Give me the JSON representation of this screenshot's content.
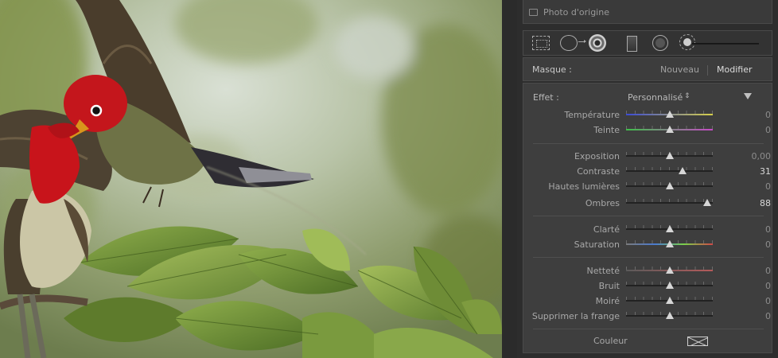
{
  "colors": {
    "panel_bg": "#2d2d2d",
    "section_bg": "#3e3e3e",
    "thumb": "#d6d6d6",
    "temperature_track": [
      "#3b4bd6",
      "#d6cf4a"
    ],
    "teinte_track": [
      "#3fbf4a",
      "#c64ac6"
    ],
    "saturation_track": [
      "#7a7a7a",
      "#d04848"
    ],
    "nettete_track": [
      "#6a6a6a",
      "#b45a5a"
    ]
  },
  "original_photo": {
    "label": "Photo d'origine",
    "checked": false
  },
  "tools": [
    {
      "name": "crop-overlay-icon"
    },
    {
      "name": "spot-removal-icon"
    },
    {
      "name": "red-eye-icon",
      "active": true
    },
    {
      "name": "graduated-filter-icon"
    },
    {
      "name": "radial-filter-icon"
    },
    {
      "name": "adjustment-brush-icon"
    }
  ],
  "mask": {
    "label": "Masque :",
    "new_label": "Nouveau",
    "edit_label": "Modifier"
  },
  "effect": {
    "label": "Effet :",
    "value": "Personnalisé",
    "caret": "⇕"
  },
  "sliders": {
    "temperature": {
      "label": "Température",
      "value": "0",
      "position": 0.5
    },
    "teinte": {
      "label": "Teinte",
      "value": "0",
      "position": 0.5
    },
    "exposition": {
      "label": "Exposition",
      "value": "0,00",
      "position": 0.5
    },
    "contraste": {
      "label": "Contraste",
      "value": "31",
      "position": 0.655
    },
    "hautes_lumieres": {
      "label": "Hautes lumières",
      "value": "0",
      "position": 0.5
    },
    "ombres": {
      "label": "Ombres",
      "value": "88",
      "position": 0.94
    },
    "clarte": {
      "label": "Clarté",
      "value": "0",
      "position": 0.5
    },
    "saturation": {
      "label": "Saturation",
      "value": "0",
      "position": 0.5
    },
    "nettete": {
      "label": "Netteté",
      "value": "0",
      "position": 0.5
    },
    "bruit": {
      "label": "Bruit",
      "value": "0",
      "position": 0.5
    },
    "moire": {
      "label": "Moiré",
      "value": "0",
      "position": 0.5
    },
    "frange": {
      "label": "Supprimer la frange",
      "value": "0",
      "position": 0.5
    }
  },
  "couleur": {
    "label": "Couleur"
  }
}
